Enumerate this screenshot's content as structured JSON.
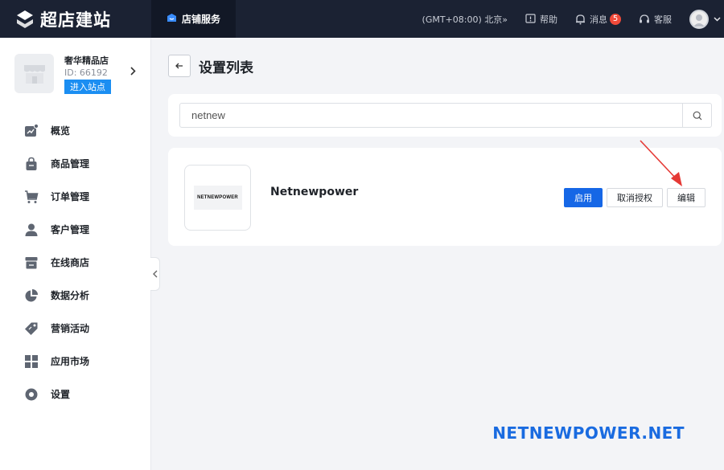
{
  "app": {
    "brand": "超店建站"
  },
  "topbar": {
    "active_tab": "店铺服务",
    "timezone": "(GMT+08:00) 北京»",
    "help": "帮助",
    "messages": "消息",
    "messages_count": "5",
    "service": "客服"
  },
  "sidebar": {
    "store_name": "奢华精品店",
    "store_id": "ID: 66192",
    "enter_site": "进入站点",
    "items": [
      {
        "label": "概览",
        "icon": "overview-icon"
      },
      {
        "label": "商品管理",
        "icon": "bag-icon"
      },
      {
        "label": "订单管理",
        "icon": "cart-icon"
      },
      {
        "label": "客户管理",
        "icon": "user-icon"
      },
      {
        "label": "在线商店",
        "icon": "store-icon"
      },
      {
        "label": "数据分析",
        "icon": "pie-chart-icon"
      },
      {
        "label": "营销活动",
        "icon": "tag-icon"
      },
      {
        "label": "应用市场",
        "icon": "grid-icon"
      },
      {
        "label": "设置",
        "icon": "gear-icon"
      }
    ]
  },
  "main": {
    "title": "设置列表",
    "search_value": "netnew",
    "app_logo_text": "NETNEWPOWER",
    "app_name": "Netnewpower",
    "btn_enable": "启用",
    "btn_revoke": "取消授权",
    "btn_edit": "编辑"
  },
  "watermark": "NETNEWPOWER.NET",
  "colors": {
    "topbar": "#1b2233",
    "primary": "#1667e6",
    "badge": "#f04a3a",
    "annotation": "#e53935",
    "watermark": "#1a6be0"
  }
}
